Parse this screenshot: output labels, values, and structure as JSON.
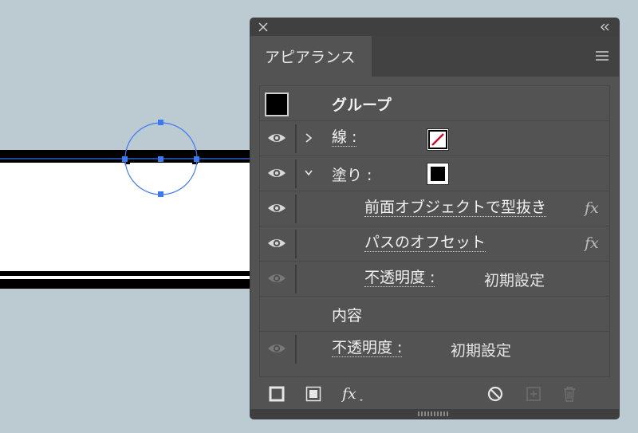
{
  "panel": {
    "tab_label": "アピアランス"
  },
  "rows": {
    "group": {
      "label": "グループ"
    },
    "stroke": {
      "label": "線 :"
    },
    "fill": {
      "label": "塗り :"
    },
    "effect1": {
      "label": "前面オブジェクトで型抜き"
    },
    "effect2": {
      "label": "パスのオフセット"
    },
    "opacity_inner": {
      "label": "不透明度 :",
      "value": "初期設定"
    },
    "contents": {
      "label": "内容"
    },
    "opacity_outer": {
      "label": "不透明度 :",
      "value": "初期設定"
    }
  },
  "icons": {
    "close": "close-icon",
    "collapse": "double-chevron-left-icon",
    "menu": "hamburger-menu-icon",
    "eye": "eye-icon",
    "fx": "fx-icon",
    "stroke_none": "stroke-none-swatch",
    "add_new_stroke": "add-stroke-icon",
    "add_new_fill": "add-fill-icon",
    "add_effect": "fx-menu-icon",
    "clear": "clear-appearance-icon",
    "duplicate": "duplicate-item-icon",
    "delete": "trash-icon"
  },
  "colors": {
    "canvas_bg": "#bccbd2",
    "panel_bg": "#535353",
    "selection_blue": "#3c78f0",
    "stroke_red": "#c8102e"
  }
}
